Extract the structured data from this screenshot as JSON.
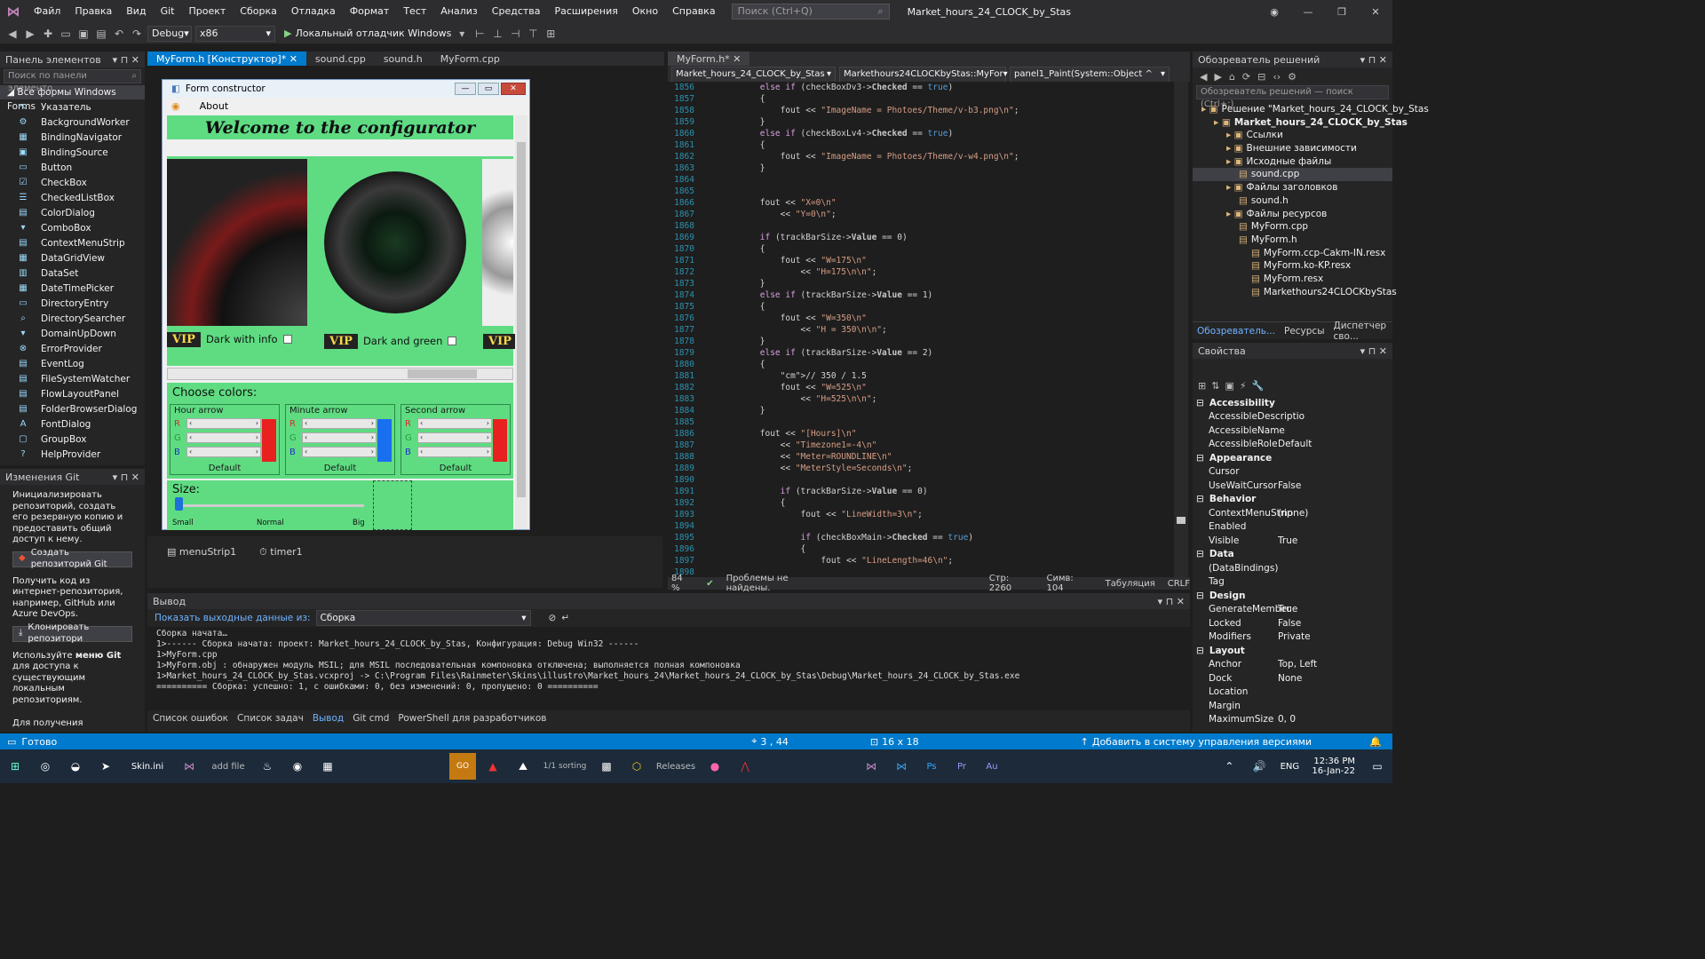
{
  "menubar": {
    "items": [
      "Файл",
      "Правка",
      "Вид",
      "Git",
      "Проект",
      "Сборка",
      "Отладка",
      "Формат",
      "Тест",
      "Анализ",
      "Средства",
      "Расширения",
      "Окно",
      "Справка"
    ],
    "search_placeholder": "Поиск (Ctrl+Q)",
    "solution_title": "Market_hours_24_CLOCK_by_Stas"
  },
  "toolbar": {
    "config": "Debug",
    "platform": "x86",
    "run_label": "Локальный отладчик Windows"
  },
  "toolbox": {
    "title": "Панель элементов",
    "search_placeholder": "Поиск по панели элементо",
    "group": "Все формы Windows Forms",
    "items": [
      "Указатель",
      "BackgroundWorker",
      "BindingNavigator",
      "BindingSource",
      "Button",
      "CheckBox",
      "CheckedListBox",
      "ColorDialog",
      "ComboBox",
      "ContextMenuStrip",
      "DataGridView",
      "DataSet",
      "DateTimePicker",
      "DirectoryEntry",
      "DirectorySearcher",
      "DomainUpDown",
      "ErrorProvider",
      "EventLog",
      "FileSystemWatcher",
      "FlowLayoutPanel",
      "FolderBrowserDialog",
      "FontDialog",
      "GroupBox",
      "HelpProvider"
    ]
  },
  "git_changes": {
    "title": "Изменения Git",
    "text1": "Инициализировать репозиторий, создать его резервную копию и предоставить общий доступ к нему.",
    "btn_create": "Создать репозиторий Git",
    "text2": "Получить код из интернет-репозитория, например, GitHub или Azure DevOps.",
    "btn_clone": "Клонировать репозитори",
    "text3_a": "Используйте ",
    "text3_b": "меню Git",
    "text3_c": " для доступа к существующим локальным репозиториям.",
    "text4": "Для получения"
  },
  "designer_tabs": [
    {
      "label": "MyForm.h [Конструктор]*",
      "active": true
    },
    {
      "label": "sound.cpp",
      "active": false
    },
    {
      "label": "sound.h",
      "active": false
    },
    {
      "label": "MyForm.cpp",
      "active": false
    }
  ],
  "form": {
    "title": "Form constructor",
    "menu_about": "About",
    "banner": "Welcome to the configurator",
    "theme1": "Dark with info",
    "theme2": "Dark and green",
    "vip": "VIP",
    "choose_colors": "Choose colors:",
    "hour": "Hour arrow",
    "minute": "Minute arrow",
    "second": "Second arrow",
    "default": "Default",
    "size": "Size:",
    "size_small": "Small",
    "size_normal": "Normal",
    "size_big": "Big",
    "rgb": [
      "R",
      "G",
      "B"
    ]
  },
  "tray": {
    "menu": "menuStrip1",
    "timer": "timer1"
  },
  "editor": {
    "tab": "MyForm.h*",
    "nav1": "Market_hours_24_CLOCK_by_Stas",
    "nav2": "Markethours24CLOCKbyStas::MyFor",
    "nav3": "panel1_Paint(System::Object ^ sende",
    "zoom": "84 %",
    "issues": "Проблемы не найдены.",
    "line": "Стр: 2260",
    "col": "Симв: 104",
    "tabs": "Табуляция",
    "eol": "CRLF"
  },
  "code_lines": [
    {
      "n": "1856",
      "t": "        else if (checkBoxDv3->Checked == true)"
    },
    {
      "n": "1857",
      "t": "        {"
    },
    {
      "n": "1858",
      "t": "            fout << \"ImageName = Photoes/Theme/v-b3.png\\n\";"
    },
    {
      "n": "1859",
      "t": "        }"
    },
    {
      "n": "1860",
      "t": "        else if (checkBoxLv4->Checked == true)"
    },
    {
      "n": "1861",
      "t": "        {"
    },
    {
      "n": "1862",
      "t": "            fout << \"ImageName = Photoes/Theme/v-w4.png\\n\";"
    },
    {
      "n": "1863",
      "t": "        }"
    },
    {
      "n": "1864",
      "t": ""
    },
    {
      "n": "1865",
      "t": ""
    },
    {
      "n": "1866",
      "t": "        fout << \"X=0\\n\""
    },
    {
      "n": "1867",
      "t": "            << \"Y=0\\n\";"
    },
    {
      "n": "1868",
      "t": ""
    },
    {
      "n": "1869",
      "t": "        if (trackBarSize->Value == 0)"
    },
    {
      "n": "1870",
      "t": "        {"
    },
    {
      "n": "1871",
      "t": "            fout << \"W=175\\n\""
    },
    {
      "n": "1872",
      "t": "                << \"H=175\\n\\n\";"
    },
    {
      "n": "1873",
      "t": "        }"
    },
    {
      "n": "1874",
      "t": "        else if (trackBarSize->Value == 1)"
    },
    {
      "n": "1875",
      "t": "        {"
    },
    {
      "n": "1876",
      "t": "            fout << \"W=350\\n\""
    },
    {
      "n": "1877",
      "t": "                << \"H = 350\\n\\n\";"
    },
    {
      "n": "1878",
      "t": "        }"
    },
    {
      "n": "1879",
      "t": "        else if (trackBarSize->Value == 2)"
    },
    {
      "n": "1880",
      "t": "        {"
    },
    {
      "n": "1881",
      "t": "            // 350 / 1.5"
    },
    {
      "n": "1882",
      "t": "            fout << \"W=525\\n\""
    },
    {
      "n": "1883",
      "t": "                << \"H=525\\n\\n\";"
    },
    {
      "n": "1884",
      "t": "        }"
    },
    {
      "n": "1885",
      "t": ""
    },
    {
      "n": "1886",
      "t": "        fout << \"[Hours]\\n\""
    },
    {
      "n": "1887",
      "t": "            << \"Timezone1=-4\\n\""
    },
    {
      "n": "1888",
      "t": "            << \"Meter=ROUNDLINE\\n\""
    },
    {
      "n": "1889",
      "t": "            << \"MeterStyle=Seconds\\n\";"
    },
    {
      "n": "1890",
      "t": ""
    },
    {
      "n": "1891",
      "t": "            if (trackBarSize->Value == 0)"
    },
    {
      "n": "1892",
      "t": "            {"
    },
    {
      "n": "1893",
      "t": "                fout << \"LineWidth=3\\n\";"
    },
    {
      "n": "1894",
      "t": ""
    },
    {
      "n": "1895",
      "t": "                if (checkBoxMain->Checked == true)"
    },
    {
      "n": "1896",
      "t": "                {"
    },
    {
      "n": "1897",
      "t": "                    fout << \"LineLength=46\\n\";"
    },
    {
      "n": "1898",
      "t": ""
    }
  ],
  "solution": {
    "title": "Обозреватель решений",
    "search_placeholder": "Обозреватель решений — поиск (Ctrl+;)",
    "items": [
      {
        "label": "Решение \"Market_hours_24_CLOCK_by_Stas",
        "indent": 0
      },
      {
        "label": "Market_hours_24_CLOCK_by_Stas",
        "indent": 1,
        "bold": true
      },
      {
        "label": "Ссылки",
        "indent": 2
      },
      {
        "label": "Внешние зависимости",
        "indent": 2
      },
      {
        "label": "Исходные файлы",
        "indent": 2
      },
      {
        "label": "sound.cpp",
        "indent": 3,
        "selected": true
      },
      {
        "label": "Файлы заголовков",
        "indent": 2
      },
      {
        "label": "sound.h",
        "indent": 3
      },
      {
        "label": "Файлы ресурсов",
        "indent": 2
      },
      {
        "label": "MyForm.cpp",
        "indent": 3
      },
      {
        "label": "MyForm.h",
        "indent": 3
      },
      {
        "label": "MyForm.ccp-Cakm-IN.resx",
        "indent": 4
      },
      {
        "label": "MyForm.ko-KP.resx",
        "indent": 4
      },
      {
        "label": "MyForm.resx",
        "indent": 4
      },
      {
        "label": "Markethours24CLOCKbyStas",
        "indent": 4
      }
    ],
    "tabs": [
      "Обозреватель...",
      "Ресурсы",
      "Диспетчер сво..."
    ]
  },
  "properties": {
    "title": "Свойства",
    "rows": [
      {
        "cat": true,
        "name": "Accessibility"
      },
      {
        "name": "AccessibleDescriptio",
        "value": ""
      },
      {
        "name": "AccessibleName",
        "value": ""
      },
      {
        "name": "AccessibleRole",
        "value": "Default"
      },
      {
        "cat": true,
        "name": "Appearance"
      },
      {
        "name": "Cursor",
        "value": ""
      },
      {
        "name": "UseWaitCursor",
        "value": "False"
      },
      {
        "cat": true,
        "name": "Behavior"
      },
      {
        "name": "ContextMenuStrip",
        "value": "(none)"
      },
      {
        "name": "Enabled",
        "value": ""
      },
      {
        "name": "Visible",
        "value": "True"
      },
      {
        "cat": true,
        "name": "Data"
      },
      {
        "name": "(DataBindings)",
        "value": ""
      },
      {
        "name": "Tag",
        "value": ""
      },
      {
        "cat": true,
        "name": "Design"
      },
      {
        "name": "GenerateMember",
        "value": "True"
      },
      {
        "name": "Locked",
        "value": "False"
      },
      {
        "name": "Modifiers",
        "value": "Private"
      },
      {
        "cat": true,
        "name": "Layout"
      },
      {
        "name": "Anchor",
        "value": "Top, Left"
      },
      {
        "name": "Dock",
        "value": "None"
      },
      {
        "name": "Location",
        "value": ""
      },
      {
        "name": "Margin",
        "value": ""
      },
      {
        "name": "MaximumSize",
        "value": "0, 0"
      }
    ]
  },
  "output": {
    "title": "Вывод",
    "show_from": "Показать выходные данные из:",
    "source": "Сборка",
    "lines": [
      "Сборка начата…",
      "1>------ Сборка начата: проект: Market_hours_24_CLOCK_by_Stas, Конфигурация: Debug Win32 ------",
      "1>MyForm.cpp",
      "1>MyForm.obj : обнаружен модуль MSIL; для MSIL последовательная компоновка отключена; выполняется полная компоновка",
      "1>Market_hours_24_CLOCK_by_Stas.vcxproj -> C:\\Program Files\\Rainmeter\\Skins\\illustro\\Market_hours_24\\Market_hours_24_CLOCK_by_Stas\\Debug\\Market_hours_24_CLOCK_by_Stas.exe",
      "========== Сборка: успешно: 1, с ошибками: 0, без изменений: 0, пропущено: 0 =========="
    ],
    "tabs": [
      "Список ошибок",
      "Список задач",
      "Вывод",
      "Git cmd",
      "PowerShell для разработчиков"
    ]
  },
  "status": {
    "ready": "Готово",
    "pos": "3 , 44",
    "size": "16 x 18",
    "vcs": "Добавить в систему управления версиями"
  },
  "taskbar": {
    "time": "12:36 PM",
    "date": "16-Jan-22",
    "lang": "ENG",
    "item_skin": "Skin.ini",
    "item_addfile": "add file",
    "item_releases": "Releases",
    "item_sorting": "1/1 sorting"
  }
}
